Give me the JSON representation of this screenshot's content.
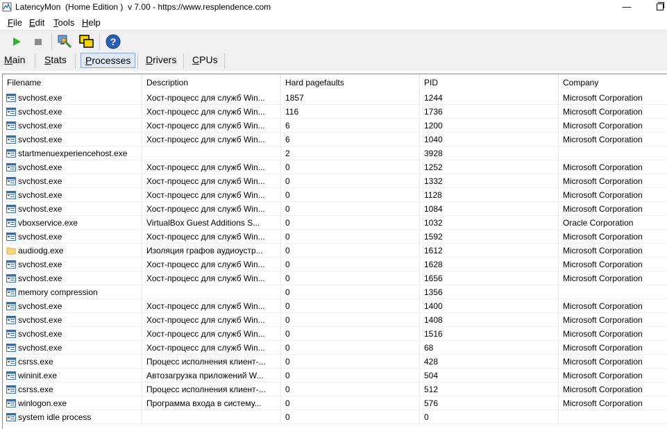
{
  "window": {
    "title": "LatencyMon  (Home Edition )  v 7.00 - https://www.resplendence.com",
    "minimize_glyph": "—",
    "app_icon": "latencymon-icon"
  },
  "menu": {
    "items": [
      "File",
      "Edit",
      "Tools",
      "Help"
    ]
  },
  "toolbar": {
    "buttons": [
      "play-icon",
      "stop-icon",
      "computer-info-icon",
      "windows-icon",
      "help-icon"
    ],
    "colors": {
      "play": "#2db82d",
      "stop": "#8c8c8c",
      "help": "#2a5fb5"
    }
  },
  "tabs": {
    "items": [
      "Main",
      "Stats",
      "Processes",
      "Drivers",
      "CPUs"
    ],
    "active": "Processes"
  },
  "table": {
    "columns": [
      "Filename",
      "Description",
      "Hard pagefaults",
      "PID",
      "Company"
    ],
    "rows": [
      {
        "icon": "app-window-icon",
        "filename": "svchost.exe",
        "description": "Хост-процесс для служб Win...",
        "faults": "1857",
        "pid": "1244",
        "company": "Microsoft Corporation"
      },
      {
        "icon": "app-window-icon",
        "filename": "svchost.exe",
        "description": "Хост-процесс для служб Win...",
        "faults": "116",
        "pid": "1736",
        "company": "Microsoft Corporation"
      },
      {
        "icon": "app-window-icon",
        "filename": "svchost.exe",
        "description": "Хост-процесс для служб Win...",
        "faults": "6",
        "pid": "1200",
        "company": "Microsoft Corporation"
      },
      {
        "icon": "app-window-icon",
        "filename": "svchost.exe",
        "description": "Хост-процесс для служб Win...",
        "faults": "6",
        "pid": "1040",
        "company": "Microsoft Corporation"
      },
      {
        "icon": "app-window-icon",
        "filename": "startmenuexperiencehost.exe",
        "description": "",
        "faults": "2",
        "pid": "3928",
        "company": ""
      },
      {
        "icon": "app-window-icon",
        "filename": "svchost.exe",
        "description": "Хост-процесс для служб Win...",
        "faults": "0",
        "pid": "1252",
        "company": "Microsoft Corporation"
      },
      {
        "icon": "app-window-icon",
        "filename": "svchost.exe",
        "description": "Хост-процесс для служб Win...",
        "faults": "0",
        "pid": "1332",
        "company": "Microsoft Corporation"
      },
      {
        "icon": "app-window-icon",
        "filename": "svchost.exe",
        "description": "Хост-процесс для служб Win...",
        "faults": "0",
        "pid": "1128",
        "company": "Microsoft Corporation"
      },
      {
        "icon": "app-window-icon",
        "filename": "svchost.exe",
        "description": "Хост-процесс для служб Win...",
        "faults": "0",
        "pid": "1084",
        "company": "Microsoft Corporation"
      },
      {
        "icon": "app-window-icon",
        "filename": "vboxservice.exe",
        "description": "VirtualBox Guest Additions S...",
        "faults": "0",
        "pid": "1032",
        "company": "Oracle Corporation"
      },
      {
        "icon": "app-window-icon",
        "filename": "svchost.exe",
        "description": "Хост-процесс для служб Win...",
        "faults": "0",
        "pid": "1592",
        "company": "Microsoft Corporation"
      },
      {
        "icon": "folder-icon",
        "filename": "audiodg.exe",
        "description": "Изоляция графов аудиоустр...",
        "faults": "0",
        "pid": "1612",
        "company": "Microsoft Corporation"
      },
      {
        "icon": "app-window-icon",
        "filename": "svchost.exe",
        "description": "Хост-процесс для служб Win...",
        "faults": "0",
        "pid": "1628",
        "company": "Microsoft Corporation"
      },
      {
        "icon": "app-window-icon",
        "filename": "svchost.exe",
        "description": "Хост-процесс для служб Win...",
        "faults": "0",
        "pid": "1656",
        "company": "Microsoft Corporation"
      },
      {
        "icon": "app-window-icon",
        "filename": "memory compression",
        "description": "",
        "faults": "0",
        "pid": "1356",
        "company": ""
      },
      {
        "icon": "app-window-icon",
        "filename": "svchost.exe",
        "description": "Хост-процесс для служб Win...",
        "faults": "0",
        "pid": "1400",
        "company": "Microsoft Corporation"
      },
      {
        "icon": "app-window-icon",
        "filename": "svchost.exe",
        "description": "Хост-процесс для служб Win...",
        "faults": "0",
        "pid": "1408",
        "company": "Microsoft Corporation"
      },
      {
        "icon": "app-window-icon",
        "filename": "svchost.exe",
        "description": "Хост-процесс для служб Win...",
        "faults": "0",
        "pid": "1516",
        "company": "Microsoft Corporation"
      },
      {
        "icon": "app-window-icon",
        "filename": "svchost.exe",
        "description": "Хост-процесс для служб Win...",
        "faults": "0",
        "pid": "68",
        "company": "Microsoft Corporation"
      },
      {
        "icon": "app-window-icon",
        "filename": "csrss.exe",
        "description": "Процесс исполнения клиент-...",
        "faults": "0",
        "pid": "428",
        "company": "Microsoft Corporation"
      },
      {
        "icon": "app-window-icon",
        "filename": "wininit.exe",
        "description": "Автозагрузка приложений W...",
        "faults": "0",
        "pid": "504",
        "company": "Microsoft Corporation"
      },
      {
        "icon": "app-window-icon",
        "filename": "csrss.exe",
        "description": "Процесс исполнения клиент-...",
        "faults": "0",
        "pid": "512",
        "company": "Microsoft Corporation"
      },
      {
        "icon": "app-window-icon",
        "filename": "winlogon.exe",
        "description": "Программа входа в систему...",
        "faults": "0",
        "pid": "576",
        "company": "Microsoft Corporation"
      },
      {
        "icon": "app-window-icon",
        "filename": "system idle process",
        "description": "",
        "faults": "0",
        "pid": "0",
        "company": ""
      }
    ]
  }
}
